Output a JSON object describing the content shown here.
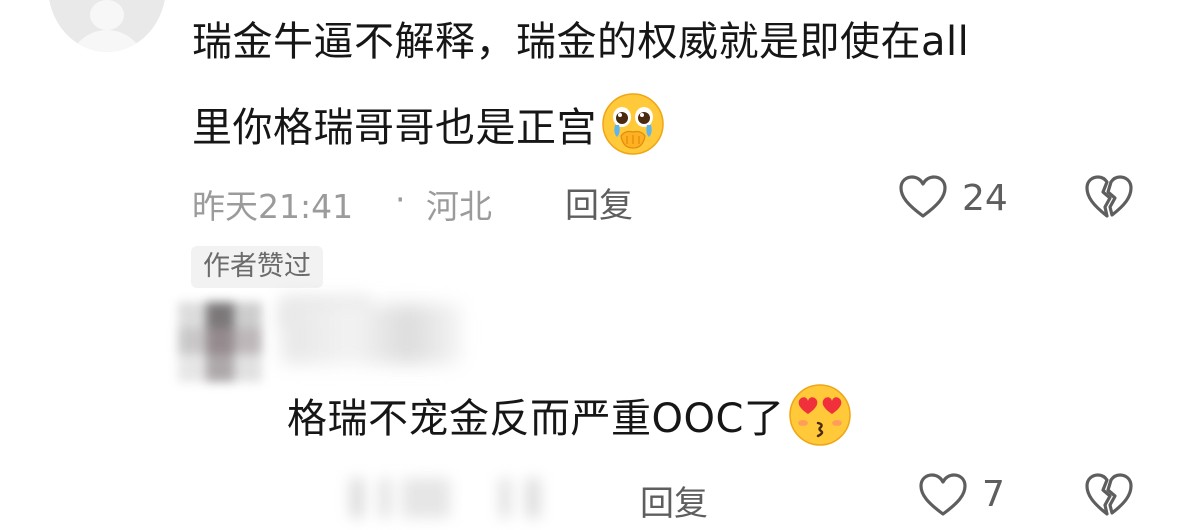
{
  "comment1": {
    "line1": "瑞金牛逼不解释，瑞金的权威就是即使在all",
    "line2": "里你格瑞哥哥也是正宫",
    "line2_emoji": "face-holding-back-tears-emoji",
    "time": "昨天21:41",
    "separator": "·",
    "location": "河北",
    "reply_label": "回复",
    "like_count": "24",
    "badge": "作者赞过"
  },
  "comment2": {
    "text": "格瑞不宠金反而严重OOC了",
    "emoji": "heart-eyes-emoji",
    "reply_label": "回复",
    "like_count": "7"
  },
  "colors": {
    "text": "#161616",
    "meta": "#9b9b9b",
    "icon": "#5e5e5e",
    "badge_bg": "#f2f2f2"
  }
}
